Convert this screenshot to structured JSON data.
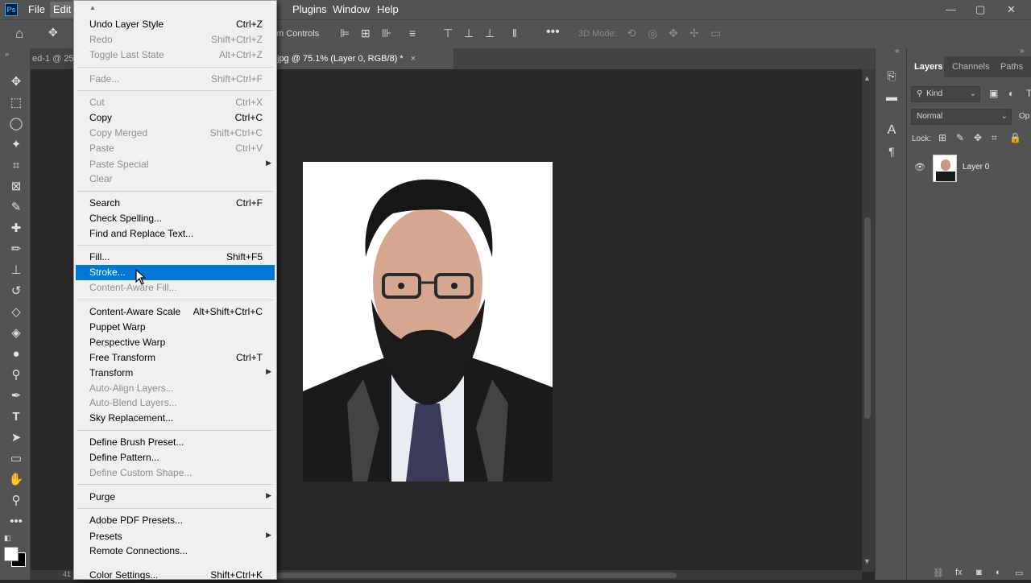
{
  "menubar": {
    "logo": "Ps",
    "items": [
      "File",
      "Edit",
      "Plugins",
      "Window",
      "Help"
    ],
    "window_controls": [
      "—",
      "▢",
      "✕"
    ]
  },
  "optionsbar": {
    "transform_controls_label": "m Controls",
    "mode_3d_label": "3D Mode:"
  },
  "document": {
    "tab_left": "ed-1 @ 25",
    "tab_active": "jpg @ 75.1% (Layer 0, RGB/8) *",
    "tab_close": "×",
    "status_text": "41"
  },
  "layers_panel": {
    "tabs": [
      "Layers",
      "Channels",
      "Paths"
    ],
    "filter_kind": "Kind",
    "blend_mode": "Normal",
    "opacity_label": "Op",
    "lock_label": "Lock:",
    "layer_name": "Layer 0"
  },
  "edit_menu": {
    "items": [
      {
        "label": "Undo Layer Style",
        "shortcut": "Ctrl+Z",
        "disabled": false
      },
      {
        "label": "Redo",
        "shortcut": "Shift+Ctrl+Z",
        "disabled": true
      },
      {
        "label": "Toggle Last State",
        "shortcut": "Alt+Ctrl+Z",
        "disabled": true
      },
      {
        "label": "Fade...",
        "shortcut": "Shift+Ctrl+F",
        "disabled": true
      },
      {
        "label": "Cut",
        "shortcut": "Ctrl+X",
        "disabled": true
      },
      {
        "label": "Copy",
        "shortcut": "Ctrl+C",
        "disabled": false
      },
      {
        "label": "Copy Merged",
        "shortcut": "Shift+Ctrl+C",
        "disabled": true
      },
      {
        "label": "Paste",
        "shortcut": "Ctrl+V",
        "disabled": true
      },
      {
        "label": "Paste Special",
        "shortcut": "",
        "disabled": true
      },
      {
        "label": "Clear",
        "shortcut": "",
        "disabled": true
      },
      {
        "label": "Search",
        "shortcut": "Ctrl+F",
        "disabled": false
      },
      {
        "label": "Check Spelling...",
        "shortcut": "",
        "disabled": false
      },
      {
        "label": "Find and Replace Text...",
        "shortcut": "",
        "disabled": false
      },
      {
        "label": "Fill...",
        "shortcut": "Shift+F5",
        "disabled": false
      },
      {
        "label": "Stroke...",
        "shortcut": "",
        "disabled": false
      },
      {
        "label": "Content-Aware Fill...",
        "shortcut": "",
        "disabled": true
      },
      {
        "label": "Content-Aware Scale",
        "shortcut": "Alt+Shift+Ctrl+C",
        "disabled": false
      },
      {
        "label": "Puppet Warp",
        "shortcut": "",
        "disabled": false
      },
      {
        "label": "Perspective Warp",
        "shortcut": "",
        "disabled": false
      },
      {
        "label": "Free Transform",
        "shortcut": "Ctrl+T",
        "disabled": false
      },
      {
        "label": "Transform",
        "shortcut": "",
        "disabled": false
      },
      {
        "label": "Auto-Align Layers...",
        "shortcut": "",
        "disabled": true
      },
      {
        "label": "Auto-Blend Layers...",
        "shortcut": "",
        "disabled": true
      },
      {
        "label": "Sky Replacement...",
        "shortcut": "",
        "disabled": false
      },
      {
        "label": "Define Brush Preset...",
        "shortcut": "",
        "disabled": false
      },
      {
        "label": "Define Pattern...",
        "shortcut": "",
        "disabled": false
      },
      {
        "label": "Define Custom Shape...",
        "shortcut": "",
        "disabled": true
      },
      {
        "label": "Purge",
        "shortcut": "",
        "disabled": false
      },
      {
        "label": "Adobe PDF Presets...",
        "shortcut": "",
        "disabled": false
      },
      {
        "label": "Presets",
        "shortcut": "",
        "disabled": false
      },
      {
        "label": "Remote Connections...",
        "shortcut": "",
        "disabled": false
      },
      {
        "label": "Color Settings...",
        "shortcut": "Shift+Ctrl+K",
        "disabled": false
      }
    ],
    "highlighted": "Stroke..."
  },
  "colors": {
    "ui_bg": "#535353",
    "canvas_bg": "#282828",
    "menu_bg": "#f0f0f0",
    "highlight": "#0078d7"
  }
}
